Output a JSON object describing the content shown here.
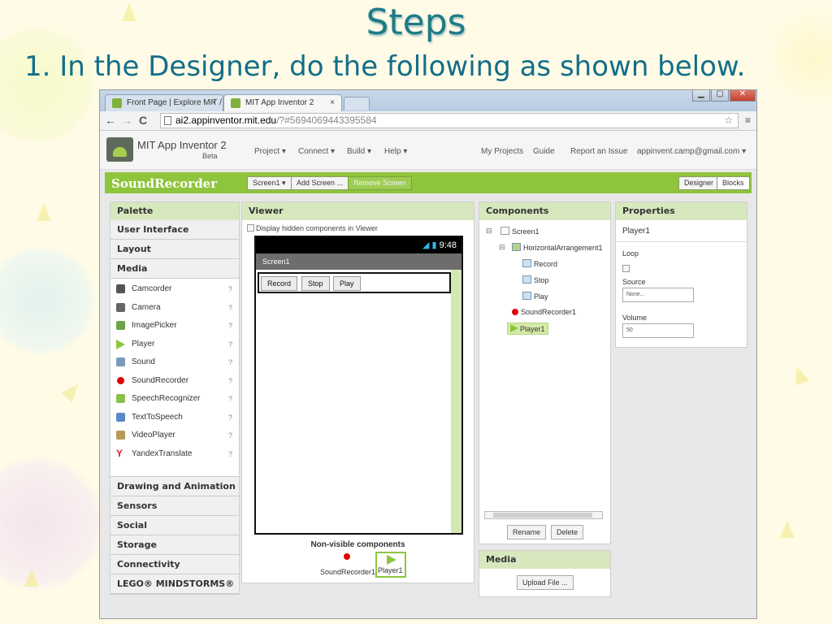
{
  "slide": {
    "title": "Steps",
    "subtitle": "1. In the Designer, do the following as shown below."
  },
  "browser": {
    "tabs": [
      {
        "label": "Front Page | Explore MIT /"
      },
      {
        "label": "MIT App Inventor 2"
      }
    ],
    "tab_close": "×",
    "window_controls": [
      "▁",
      "▢",
      "✕"
    ],
    "nav": {
      "back": "←",
      "forward": "→",
      "reload": "C"
    },
    "address_host": "ai2.appinventor.mit.edu",
    "address_path": "/?#5694069443395584",
    "toolbar_icons": [
      "☆",
      "≡"
    ]
  },
  "app": {
    "name": "MIT App Inventor 2",
    "beta": "Beta",
    "menus": [
      "Project ▾",
      "Connect ▾",
      "Build ▾",
      "Help ▾"
    ],
    "links": [
      "My Projects",
      "Guide",
      "Report an Issue",
      "appinvent.camp@gmail.com ▾"
    ],
    "project_name": "SoundRecorder",
    "screen_select": "Screen1 ▾",
    "add_screen": "Add Screen ...",
    "remove_screen": "Remove Screen",
    "designer": "Designer",
    "blocks": "Blocks"
  },
  "palette": {
    "title": "Palette",
    "categories_top": [
      "User Interface",
      "Layout",
      "Media"
    ],
    "items": [
      {
        "label": "Camcorder",
        "icon": "camcorder-icon",
        "color": "#555555"
      },
      {
        "label": "Camera",
        "icon": "camera-icon",
        "color": "#666666"
      },
      {
        "label": "ImagePicker",
        "icon": "image-picker-icon",
        "color": "#6aa34a"
      },
      {
        "label": "Player",
        "icon": "player-icon",
        "color": "#8cc63f"
      },
      {
        "label": "Sound",
        "icon": "sound-icon",
        "color": "#7a9ac0"
      },
      {
        "label": "SoundRecorder",
        "icon": "sound-recorder-icon",
        "color": "#e00000"
      },
      {
        "label": "SpeechRecognizer",
        "icon": "speech-recognizer-icon",
        "color": "#8bbf4a"
      },
      {
        "label": "TextToSpeech",
        "icon": "text-to-speech-icon",
        "color": "#5b88c7"
      },
      {
        "label": "VideoPlayer",
        "icon": "video-player-icon",
        "color": "#b89a56"
      },
      {
        "label": "YandexTranslate",
        "icon": "yandex-translate-icon",
        "color": "#e31b23"
      }
    ],
    "help": "?",
    "categories_bottom": [
      "Drawing and Animation",
      "Sensors",
      "Social",
      "Storage",
      "Connectivity",
      "LEGO® MINDSTORMS®"
    ]
  },
  "viewer": {
    "title": "Viewer",
    "hidden_checkbox": "Display hidden components in Viewer",
    "status_time": "9:48",
    "screen_title": "Screen1",
    "buttons": [
      "Record",
      "Stop",
      "Play"
    ],
    "nonvisible_title": "Non-visible components",
    "nonvisible_items": [
      "SoundRecorder1",
      "Player1"
    ]
  },
  "components": {
    "title": "Components",
    "tree": [
      {
        "label": "Screen1"
      },
      {
        "label": "HorizontalArrangement1"
      },
      {
        "label": "Record"
      },
      {
        "label": "Stop"
      },
      {
        "label": "Play"
      },
      {
        "label": "SoundRecorder1"
      },
      {
        "label": "Player1"
      }
    ],
    "collapse": "⊟",
    "rename": "Rename",
    "delete": "Delete"
  },
  "media": {
    "title": "Media",
    "upload": "Upload File ..."
  },
  "properties": {
    "title": "Properties",
    "component": "Player1",
    "loop_label": "Loop",
    "source_label": "Source",
    "source_value": "None...",
    "volume_label": "Volume",
    "volume_value": "50"
  }
}
